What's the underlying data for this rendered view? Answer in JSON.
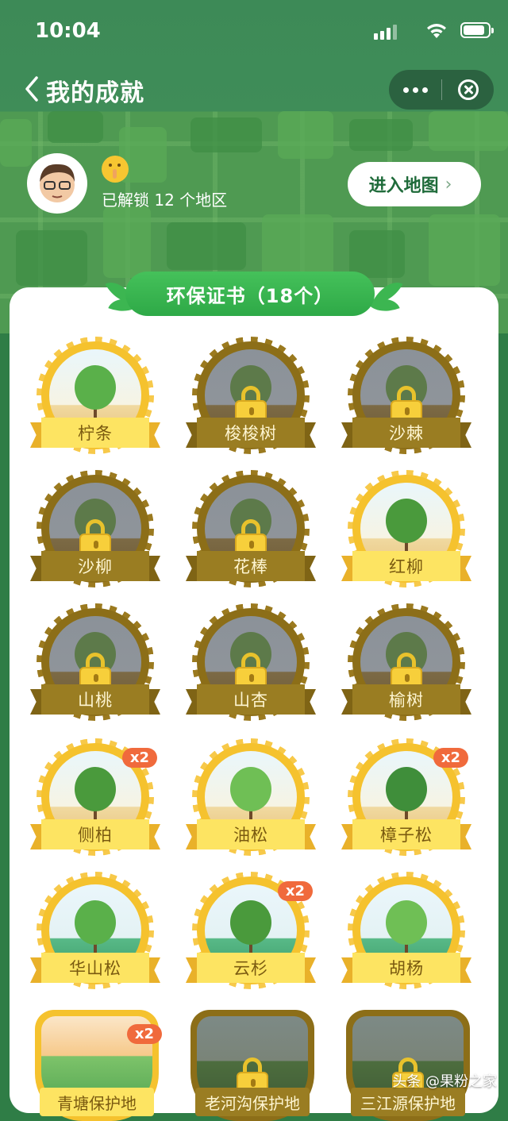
{
  "status_bar": {
    "time": "10:04"
  },
  "nav": {
    "title": "我的成就"
  },
  "profile": {
    "unlocked_text": "已解锁 12 个地区",
    "map_button": "进入地图"
  },
  "section": {
    "title": "环保证书（18个）"
  },
  "certificates": [
    {
      "name": "柠条",
      "unlocked": true,
      "count": ""
    },
    {
      "name": "梭梭树",
      "unlocked": false,
      "count": ""
    },
    {
      "name": "沙棘",
      "unlocked": false,
      "count": ""
    },
    {
      "name": "沙柳",
      "unlocked": false,
      "count": ""
    },
    {
      "name": "花棒",
      "unlocked": false,
      "count": ""
    },
    {
      "name": "红柳",
      "unlocked": true,
      "count": ""
    },
    {
      "name": "山桃",
      "unlocked": false,
      "count": ""
    },
    {
      "name": "山杏",
      "unlocked": false,
      "count": ""
    },
    {
      "name": "榆树",
      "unlocked": false,
      "count": ""
    },
    {
      "name": "侧柏",
      "unlocked": true,
      "count": "x2"
    },
    {
      "name": "油松",
      "unlocked": true,
      "count": ""
    },
    {
      "name": "樟子松",
      "unlocked": true,
      "count": "x2"
    },
    {
      "name": "华山松",
      "unlocked": true,
      "count": ""
    },
    {
      "name": "云杉",
      "unlocked": true,
      "count": "x2"
    },
    {
      "name": "胡杨",
      "unlocked": true,
      "count": ""
    }
  ],
  "reserve_badges": [
    {
      "name": "青塘保护地",
      "unlocked": true,
      "count": "x2"
    },
    {
      "name": "老河沟保护地",
      "unlocked": false,
      "count": ""
    },
    {
      "name": "三江源保护地",
      "unlocked": false,
      "count": ""
    }
  ],
  "watermark": "头条 @果粉之家",
  "colors": {
    "brand_green": "#2ea947",
    "gold": "#f5c22e",
    "bronze": "#8c6e18",
    "badge_count": "#f06a3c"
  }
}
